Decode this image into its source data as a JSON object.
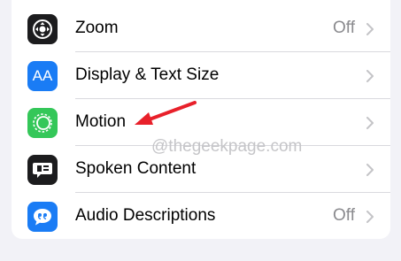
{
  "settings": {
    "rows": [
      {
        "label": "Zoom",
        "value": "Off",
        "icon": "zoom-icon",
        "icon_bg": "#1c1c1e"
      },
      {
        "label": "Display & Text Size",
        "value": "",
        "icon": "display-text-size-icon",
        "icon_text": "AA",
        "icon_bg": "#1a7cf5"
      },
      {
        "label": "Motion",
        "value": "",
        "icon": "motion-icon",
        "icon_bg": "#34c759"
      },
      {
        "label": "Spoken Content",
        "value": "",
        "icon": "spoken-content-icon",
        "icon_bg": "#1c1c1e"
      },
      {
        "label": "Audio Descriptions",
        "value": "Off",
        "icon": "audio-descriptions-icon",
        "icon_bg": "#1a7cf5"
      }
    ]
  },
  "watermark": "@thegeekpage.com",
  "annotation": {
    "arrow_color": "#e8202a"
  }
}
